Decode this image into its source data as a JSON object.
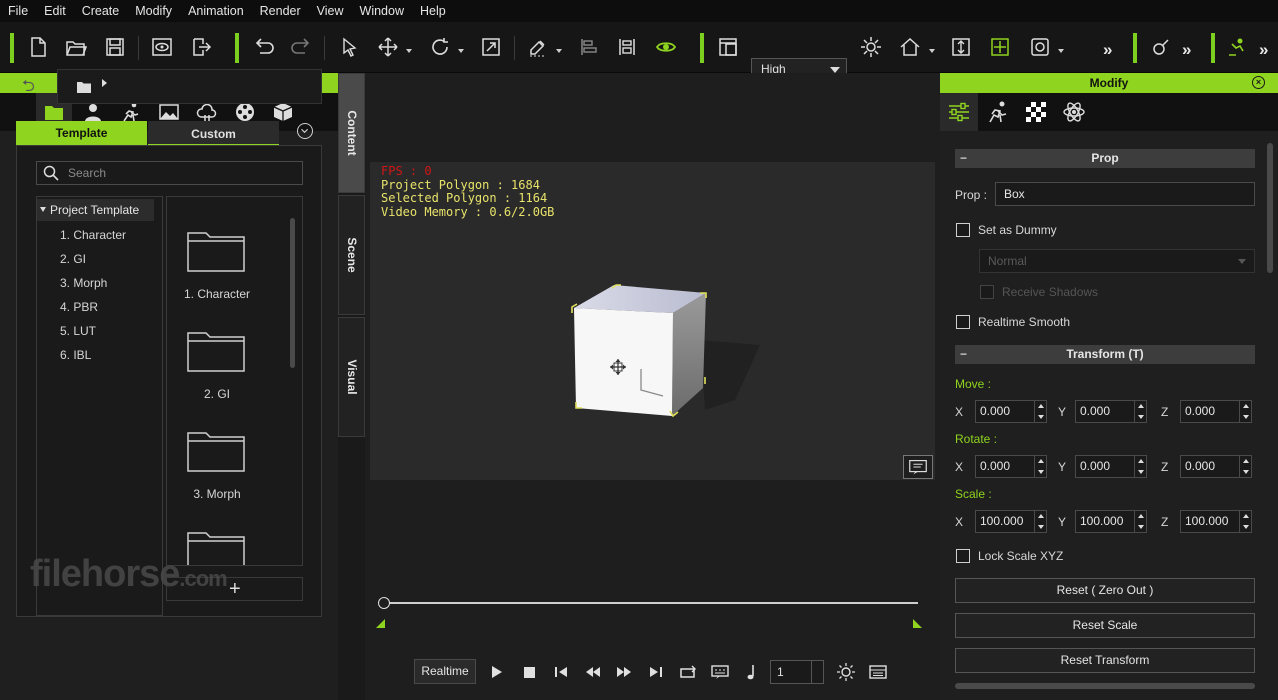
{
  "menu": [
    "File",
    "Edit",
    "Create",
    "Modify",
    "Animation",
    "Render",
    "View",
    "Window",
    "Help"
  ],
  "toolbar": {
    "quality": "High",
    "icons": [
      "new-file-icon",
      "open-folder-icon",
      "save-icon",
      "preview-icon",
      "export-icon",
      "undo-icon",
      "redo-icon",
      "select-arrow-icon",
      "move-icon",
      "rotate-icon",
      "scale-icon",
      "pick-icon",
      "align-icon",
      "distribute-icon",
      "visibility-eye-icon",
      "layout-icon",
      "light-icon",
      "home-icon",
      "fit-icon",
      "frame-icon",
      "camera-icon",
      "more-icon"
    ]
  },
  "content_panel": {
    "title": "Content",
    "tabs": [
      "folder-icon",
      "actor-icon",
      "motion-icon",
      "stage-icon",
      "scene-icon",
      "media-icon",
      "props-icon"
    ],
    "template_tab": "Template",
    "custom_tab": "Custom",
    "search_placeholder": "Search",
    "tree": {
      "root": "Project Template",
      "items": [
        "1. Character",
        "2. GI",
        "3. Morph",
        "4. PBR",
        "5. LUT",
        "6. IBL"
      ]
    },
    "grid": [
      "1. Character",
      "2. GI",
      "3. Morph"
    ]
  },
  "watermark": {
    "text": "filehorse",
    "suffix": ".com"
  },
  "side_tabs": [
    "Content",
    "Scene",
    "Visual"
  ],
  "viewport": {
    "fps": "FPS : 0",
    "project_polygon": "Project Polygon : 1684",
    "selected_polygon": "Selected Polygon : 1164",
    "video_memory": "Video Memory : 0.6/2.0GB"
  },
  "playback": {
    "mode": "Realtime",
    "frame": "1"
  },
  "modify_panel": {
    "title": "Modify",
    "prop_section": "Prop",
    "prop_label": "Prop :",
    "prop_value": "Box",
    "set_as_dummy": "Set as Dummy",
    "shadow_mode": "Normal",
    "receive_shadows": "Receive Shadows",
    "realtime_smooth": "Realtime Smooth",
    "transform_section": "Transform  (T)",
    "move_label": "Move :",
    "rotate_label": "Rotate :",
    "scale_label": "Scale :",
    "axis_x": "X",
    "axis_y": "Y",
    "axis_z": "Z",
    "move": {
      "x": "0.000",
      "y": "0.000",
      "z": "0.000"
    },
    "rotate": {
      "x": "0.000",
      "y": "0.000",
      "z": "0.000"
    },
    "scale": {
      "x": "100.000",
      "y": "100.000",
      "z": "100.000"
    },
    "lock_scale": "Lock Scale XYZ",
    "reset_zero": "Reset ( Zero Out )",
    "reset_scale": "Reset Scale",
    "reset_transform": "Reset Transform"
  },
  "colors": {
    "accent": "#8fd41e",
    "fps": "#d01616",
    "stats": "#e8e36a"
  }
}
